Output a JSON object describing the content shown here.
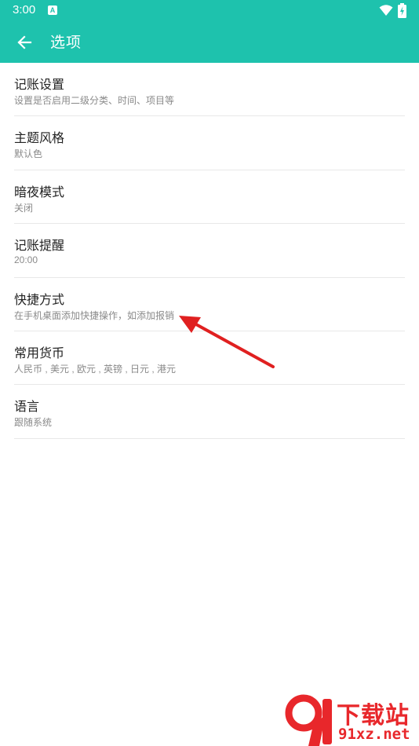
{
  "status_bar": {
    "time": "3:00",
    "notification_icon": "A",
    "icons": [
      "wifi-icon",
      "battery-charging-icon"
    ]
  },
  "app_bar": {
    "back_icon": "arrow-left-icon",
    "title": "选项"
  },
  "colors": {
    "primary": "#1ec2ad",
    "title_text": "#222222",
    "subtitle_text": "#8a8a8a",
    "divider": "#e8e8e8",
    "annotation_arrow": "#e02020",
    "watermark": "#e8272b"
  },
  "settings": [
    {
      "title": "记账设置",
      "subtitle": "设置是否启用二级分类、时间、项目等"
    },
    {
      "title": "主题风格",
      "subtitle": "默认色"
    },
    {
      "title": "暗夜模式",
      "subtitle": "关闭"
    },
    {
      "title": "记账提醒",
      "subtitle": "20:00"
    },
    {
      "title": "快捷方式",
      "subtitle": "在手机桌面添加快捷操作，如添加报销"
    },
    {
      "title": "常用货币",
      "subtitle": "人民币 , 美元 , 欧元 , 英镑 , 日元 , 港元"
    },
    {
      "title": "语言",
      "subtitle": "跟随系统"
    }
  ],
  "watermark": {
    "name": "下载站",
    "url": "91xz.net"
  }
}
